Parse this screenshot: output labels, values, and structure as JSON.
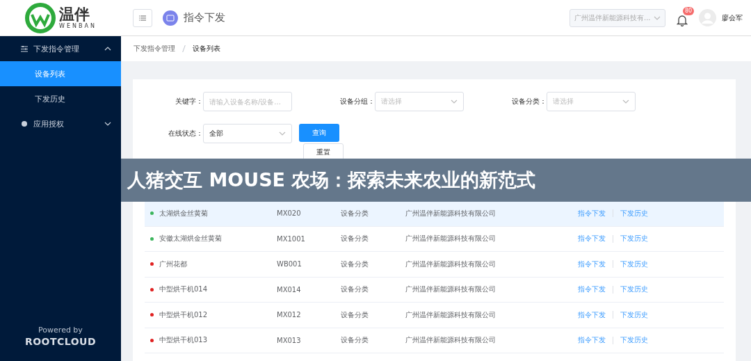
{
  "header": {
    "logo_text": "温伴",
    "logo_subtext": "WENBAN",
    "page_title": "指令下发",
    "company_select": "广州温伴新能源科技有...",
    "notification_count": "80",
    "user_name": "廖会军"
  },
  "sidebar": {
    "items": [
      {
        "label": "下发指令管理",
        "expanded": true,
        "children": [
          {
            "label": "设备列表",
            "selected": true
          },
          {
            "label": "下发历史",
            "selected": false
          }
        ]
      },
      {
        "label": "应用授权",
        "expanded": false
      }
    ],
    "powered_by": "Powered by",
    "brand": "ROOTCLOUD"
  },
  "breadcrumb": [
    {
      "label": "下发指令管理"
    },
    {
      "label": "设备列表"
    }
  ],
  "filters": [
    {
      "kind": "input",
      "label": "关键字：",
      "placeholder": "请输入设备名称/设备..."
    },
    {
      "kind": "select",
      "label": "设备分组：",
      "placeholder": "请选择"
    },
    {
      "kind": "select",
      "label": "设备分类：",
      "placeholder": "请选择"
    },
    {
      "kind": "select",
      "label": "在线状态：",
      "value": "全部"
    }
  ],
  "buttons": {
    "query": "查询",
    "reset": "重置"
  },
  "banner": "人猪交互 MOUSE 农场：探索未来农业的新范式",
  "table": {
    "rows": [
      {
        "name": "太湖烘金丝黄菊",
        "code": "MX020",
        "category": "设备分类",
        "company": "广州温伴新能源科技有限公司",
        "color": "#3bb55c",
        "selected": true,
        "actions": [
          "指令下发",
          "下发历史"
        ]
      },
      {
        "name": "安徽太湖烘金丝黄菊",
        "code": "MX1001",
        "category": "设备分类",
        "company": "广州温伴新能源科技有限公司",
        "color": "#3bb55c",
        "selected": false,
        "actions": [
          "指令下发",
          "下发历史"
        ]
      },
      {
        "name": "广州花都",
        "code": "WB001",
        "category": "设备分类",
        "company": "广州温伴新能源科技有限公司",
        "color": "#e02020",
        "selected": false,
        "actions": [
          "指令下发",
          "下发历史"
        ]
      },
      {
        "name": "中型烘干机014",
        "code": "MX014",
        "category": "设备分类",
        "company": "广州温伴新能源科技有限公司",
        "color": "#e02020",
        "selected": false,
        "actions": [
          "指令下发",
          "下发历史"
        ]
      },
      {
        "name": "中型烘干机012",
        "code": "MX012",
        "category": "设备分类",
        "company": "广州温伴新能源科技有限公司",
        "color": "#e02020",
        "selected": false,
        "actions": [
          "指令下发",
          "下发历史"
        ]
      },
      {
        "name": "中型烘干机013",
        "code": "MX013",
        "category": "设备分类",
        "company": "广州温伴新能源科技有限公司",
        "color": "#e02020",
        "selected": false,
        "actions": [
          "指令下发",
          "下发历史"
        ]
      }
    ]
  }
}
